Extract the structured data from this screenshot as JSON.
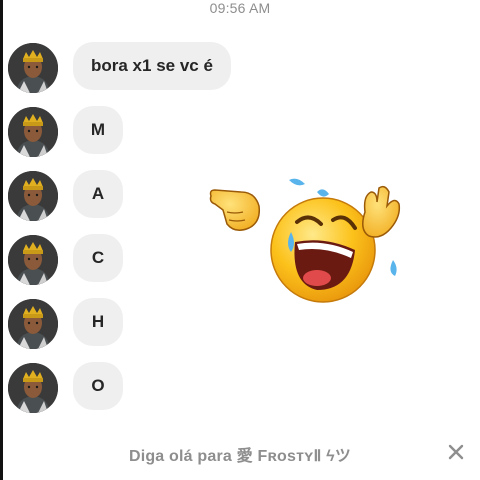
{
  "header": {
    "timestamp": "09:56 AM"
  },
  "messages": [
    {
      "text": "bora x1 se vc é"
    },
    {
      "text": "M"
    },
    {
      "text": "A"
    },
    {
      "text": "C"
    },
    {
      "text": "H"
    },
    {
      "text": "O"
    }
  ],
  "sticker": {
    "icon": "laughing-crying-emoji-sticker"
  },
  "footer": {
    "prompt": "Diga olá para 愛 FʀᴏsᴛʏⅡ ϟツ",
    "close_icon": "close-icon"
  },
  "colors": {
    "bubble": "#efefef",
    "text": "#262626",
    "muted": "#8e8e8e"
  }
}
